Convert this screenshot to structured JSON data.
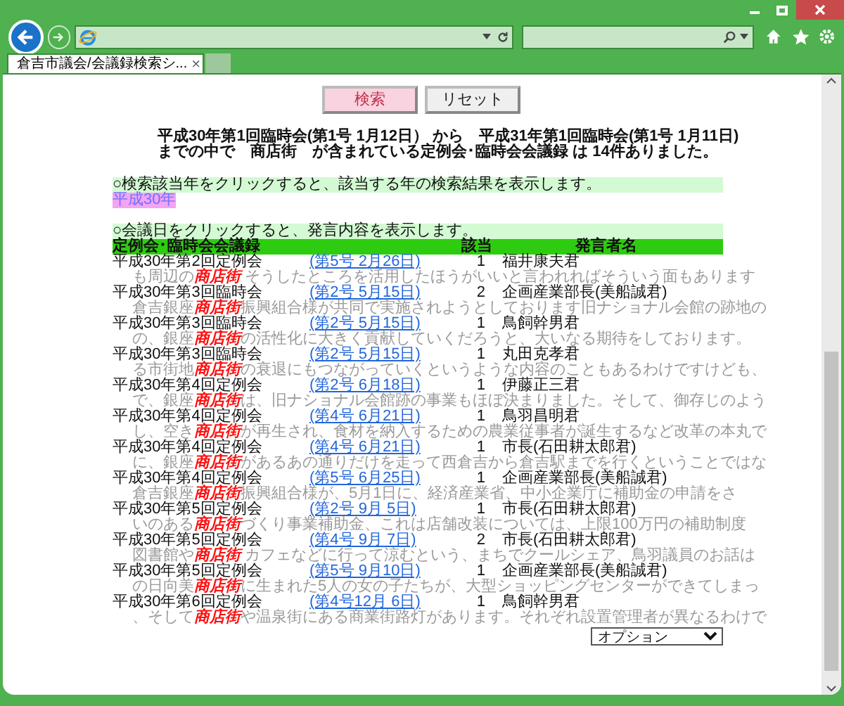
{
  "browser": {
    "tab": {
      "title": "倉吉市議会/会議録検索シ...",
      "close": "×"
    }
  },
  "buttons": [
    {
      "label": "検索",
      "kind": "primary"
    },
    {
      "label": "リセット",
      "kind": "secondary"
    }
  ],
  "summary": "平成30年第1回臨時会(第1号 1月12日） から　平成31年第1回臨時会(第1号 1月11日)までの中で　商店街　が含まれている定例会･臨時会会議録 は 14件ありました。",
  "year_hint": "○検索該当年をクリックすると、該当する年の検索結果を表示します。",
  "years": [
    {
      "label": "平成30年"
    }
  ],
  "date_hint": "○会議日をクリックすると、発言内容を表示します。",
  "table": {
    "columns": [
      "定例会･臨時会会議録",
      "該当",
      "発言者名"
    ],
    "rows": [
      {
        "meeting": "平成30年第2回定例会",
        "date": "(第5号 2月26日)",
        "count": "1",
        "speaker": "福井康夫君",
        "before": "も周辺の",
        "keyword": "商店街",
        "after": " そうしたところを活用したほうがいいと言われればそういう面もあります"
      },
      {
        "meeting": "平成30年第3回臨時会",
        "date": "(第2号 5月15日)",
        "count": "2",
        "speaker": "企画産業部長(美船誠君)",
        "before": "倉吉銀座",
        "keyword": "商店街",
        "after": "振興組合様が共同で実施されようとしております旧ナショナル会館の跡地の"
      },
      {
        "meeting": "平成30年第3回臨時会",
        "date": "(第2号 5月15日)",
        "count": "1",
        "speaker": "鳥飼幹男君",
        "before": "の、銀座",
        "keyword": "商店街",
        "after": "の活性化に大きく貢献していくだろうと、大いなる期待をしております。"
      },
      {
        "meeting": "平成30年第3回臨時会",
        "date": "(第2号 5月15日)",
        "count": "1",
        "speaker": "丸田克孝君",
        "before": "る市街地",
        "keyword": "商店街",
        "after": "の衰退にもつながっていくというような内容のこともあるわけですけども、"
      },
      {
        "meeting": "平成30年第4回定例会",
        "date": "(第2号 6月18日)",
        "count": "1",
        "speaker": "伊藤正三君",
        "before": "で、銀座",
        "keyword": "商店街",
        "after": "は、旧ナショナル会館跡の事業もほぼ決まりました。そして、御存じのよう"
      },
      {
        "meeting": "平成30年第4回定例会",
        "date": "(第4号 6月21日)",
        "count": "1",
        "speaker": "鳥羽昌明君",
        "before": "し、空き",
        "keyword": "商店街",
        "after": "が再生され、食材を納入するための農業従事者が誕生するなど改革の本丸で"
      },
      {
        "meeting": "平成30年第4回定例会",
        "date": "(第4号 6月21日)",
        "count": "1",
        "speaker": "市長(石田耕太郎君)",
        "before": "に、銀座",
        "keyword": "商店街",
        "after": "があるあの通りだけを走って西倉吉から倉吉駅までを行くということではな"
      },
      {
        "meeting": "平成30年第4回定例会",
        "date": "(第5号 6月25日)",
        "count": "1",
        "speaker": "企画産業部長(美船誠君)",
        "before": "倉吉銀座",
        "keyword": "商店街",
        "after": "振興組合様が、5月1日に、経済産業省、中小企業庁に補助金の申請をさ"
      },
      {
        "meeting": "平成30年第5回定例会",
        "date": "(第2号 9月 5日)",
        "count": "1",
        "speaker": "市長(石田耕太郎君)",
        "before": "いのある",
        "keyword": "商店街",
        "after": "づくり事業補助金、これは店舗改装については、上限100万円の補助制度"
      },
      {
        "meeting": "平成30年第5回定例会",
        "date": "(第4号 9月 7日)",
        "count": "2",
        "speaker": "市長(石田耕太郎君)",
        "before": "図書館や",
        "keyword": "商店街",
        "after": " カフェなどに行って涼むという、まちでクールシェア、鳥羽議員のお話は"
      },
      {
        "meeting": "平成30年第5回定例会",
        "date": "(第5号 9月10日)",
        "count": "1",
        "speaker": "企画産業部長(美船誠君)",
        "before": "の日向美",
        "keyword": "商店街",
        "after": "に生まれた5人の女の子たちが、大型ショッピングセンターができてしまっ"
      },
      {
        "meeting": "平成30年第6回定例会",
        "date": "(第4号12月 6日)",
        "count": "1",
        "speaker": "鳥飼幹男君",
        "before": "、そして",
        "keyword": "商店街",
        "after": "や温泉街にある商業街路灯があります。それぞれ設置管理者が異なるわけで"
      }
    ]
  },
  "option_select": {
    "value": "オプション"
  }
}
